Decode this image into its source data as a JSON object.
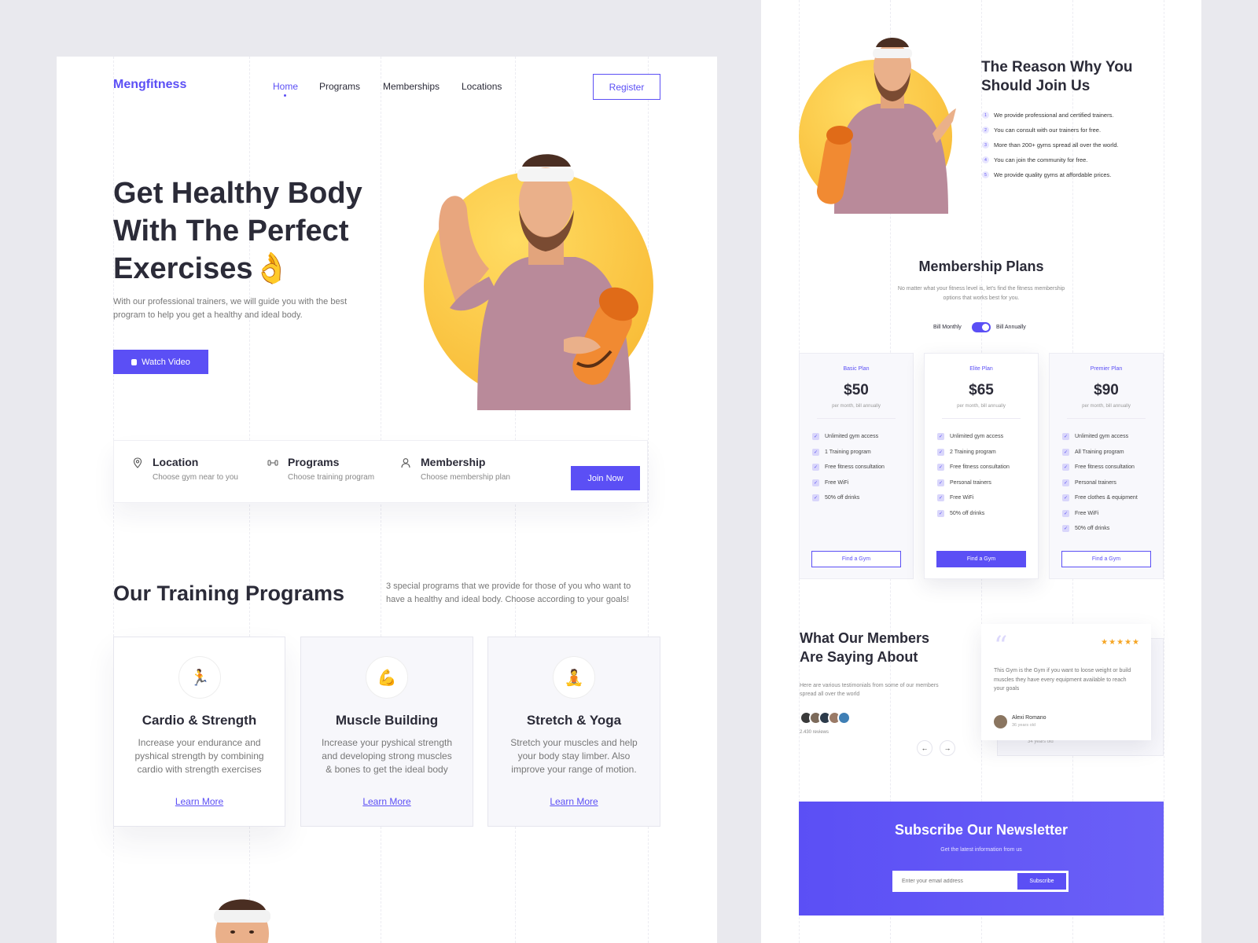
{
  "brand": {
    "name": "Mengfitness"
  },
  "nav": {
    "items": [
      "Home",
      "Programs",
      "Memberships",
      "Locations"
    ],
    "register": "Register"
  },
  "hero": {
    "title_line1": "Get Healthy Body",
    "title_line2": "With The Perfect",
    "title_line3": "Exercises👌",
    "desc_line1": "With our professional trainers, we will guide you with the best",
    "desc_line2": "program to help you get a healthy and ideal body.",
    "cta": "Watch Video"
  },
  "features": [
    {
      "icon": "location-pin-icon",
      "title": "Location",
      "subtitle": "Choose gym near to you"
    },
    {
      "icon": "dumbbell-icon",
      "title": "Programs",
      "subtitle": "Choose training program"
    },
    {
      "icon": "user-icon",
      "title": "Membership",
      "subtitle": "Choose membership plan"
    }
  ],
  "join_now": "Join Now",
  "training": {
    "title": "Our Training Programs",
    "desc_line1": "3 special programs that we provide for those of you who want to",
    "desc_line2": "have a healthy and ideal body. Choose according to your goals!",
    "cards": [
      {
        "icon": "🏃",
        "title": "Cardio & Strength",
        "desc": "Increase your endurance and pyshical strength by combining cardio with strength exercises",
        "link": "Learn More"
      },
      {
        "icon": "💪",
        "title": "Muscle Building",
        "desc": "Increase your pyshical strength and developing strong muscles & bones to get the ideal body",
        "link": "Learn More"
      },
      {
        "icon": "🧘",
        "title": "Stretch & Yoga",
        "desc": "Stretch your muscles and help your body stay limber. Also improve your range of motion.",
        "link": "Learn More"
      }
    ]
  },
  "reason": {
    "title_line1": "The Reason Why You",
    "title_line2": "Should Join Us",
    "items": [
      {
        "n": "1",
        "text": "We provide professional and certified trainers."
      },
      {
        "n": "2",
        "text": "You can consult with our trainers for free."
      },
      {
        "n": "3",
        "text": "More than 200+ gyms spread all over the world."
      },
      {
        "n": "4",
        "text": "You can join the community for free."
      },
      {
        "n": "5",
        "text": "We provide quality gyms at affordable prices."
      }
    ]
  },
  "membership": {
    "title": "Membership Plans",
    "desc_line1": "No matter what your fitness level is, let's find the fitness membership",
    "desc_line2": "options that works best for you.",
    "bill_monthly": "Bill Monthly",
    "bill_annually": "Bill Annually",
    "toggle_on": true,
    "plans": [
      {
        "name": "Basic Plan",
        "price": "$50",
        "period": "per month, bill annually",
        "features": [
          "Unlimited gym access",
          "1 Training program",
          "Free fitness consultation",
          "Free WiFi",
          "50% off drinks"
        ],
        "button": "Find a Gym"
      },
      {
        "name": "Elite Plan",
        "price": "$65",
        "period": "per month, bill annually",
        "features": [
          "Unlimited gym access",
          "2 Training program",
          "Free fitness consultation",
          "Personal trainers",
          "Free WiFi",
          "50% off drinks"
        ],
        "button": "Find a Gym"
      },
      {
        "name": "Premier Plan",
        "price": "$90",
        "period": "per month, bill annually",
        "features": [
          "Unlimited gym access",
          "All Training program",
          "Free fitness consultation",
          "Personal trainers",
          "Free clothes & equipment",
          "Free WiFi",
          "50% off drinks"
        ],
        "button": "Find a Gym"
      }
    ]
  },
  "testimonials": {
    "title_line1": "What Our Members",
    "title_line2": "Are Saying About",
    "desc_line1": "Here are various testimonials from some of our members",
    "desc_line2": "spread all over the world",
    "reviews_count": "2.430 reviews",
    "rating": 5,
    "review": {
      "quote": "This Gym is the Gym if you want to loose weight or build muscles they have every equipment available to reach your goals",
      "name": "Alexi Romano",
      "meta": "36 years old"
    },
    "back_meta": "34 years old"
  },
  "newsletter": {
    "title": "Subscribe Our Newsletter",
    "subtitle": "Get the latest information from us",
    "placeholder": "Enter your email address",
    "button": "Subscribe"
  },
  "colors": {
    "accent": "#5b4ff5",
    "yellow": "#fcc43c",
    "text": "#2b2b38"
  }
}
